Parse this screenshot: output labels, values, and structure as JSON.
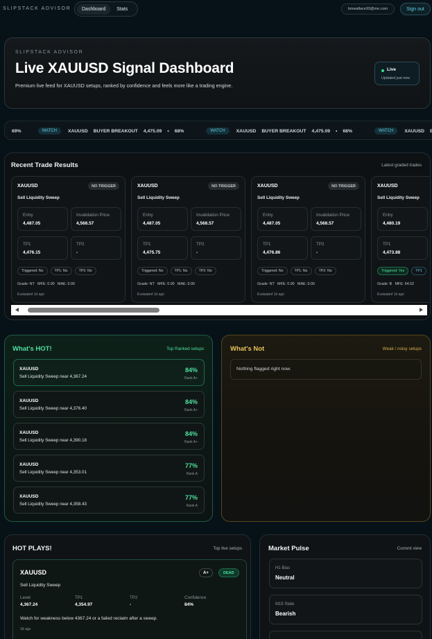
{
  "nav": {
    "brand": "SLIPSTACK ADVISOR",
    "tabs": [
      {
        "label": "Dashboard"
      },
      {
        "label": "Stats"
      }
    ],
    "email": "bmwallace93@me.com",
    "signout": "Sign out"
  },
  "hero": {
    "eyebrow": "SLIPSTACK ADVISOR",
    "title": "Live XAUUSD Signal Dashboard",
    "subtitle": "Premium live feed for XAUUSD setups, ranked by confidence and feels more like a trading engine.",
    "status_label": "Live",
    "status_updated": "Updated just now",
    "status_color": "#37e08b"
  },
  "ticker": {
    "lead_pct": "69%",
    "items": [
      {
        "badge": "WATCH",
        "symbol": "XAUUSD",
        "type": "BUYER BREAKOUT",
        "price": "4,475.09",
        "pct": "68%"
      },
      {
        "badge": "WATCH",
        "symbol": "XAUUSD",
        "type": "BUYER BREAKOUT",
        "price": "4,475.09",
        "pct": "68%"
      },
      {
        "badge": "WATCH",
        "symbol": "XAUUSD",
        "type": "BUYER BREAKOUT",
        "price": "",
        "pct": ""
      }
    ]
  },
  "results": {
    "title": "Recent Trade Results",
    "meta": "Latest graded trades",
    "labels": {
      "entry": "Entry",
      "invalidation": "Invalidation Price",
      "tp1": "TP1",
      "tp2": "TP2",
      "mfe": "MFE:",
      "mae": "MAE:"
    },
    "cards": [
      {
        "symbol": "XAUUSD",
        "badge": "NO TRIGGER",
        "setup": "Sell Liquidity Sweep",
        "entry": "4,487.05",
        "invalidation": "4,568.57",
        "tp1": "4,476.15",
        "tp2": "-",
        "chips": [
          "Triggered: No",
          "TP1: No",
          "TP2: No"
        ],
        "grade": "Grade: NT",
        "mfe": "0.00",
        "mae": "0.00",
        "evaluated": "Evaluated 1d ago"
      },
      {
        "symbol": "XAUUSD",
        "badge": "NO TRIGGER",
        "setup": "Sell Liquidity Sweep",
        "entry": "4,487.05",
        "invalidation": "4,568.57",
        "tp1": "4,475.75",
        "tp2": "-",
        "chips": [
          "Triggered: No",
          "TP1: No",
          "TP2: No"
        ],
        "grade": "Grade: NT",
        "mfe": "0.00",
        "mae": "0.00",
        "evaluated": "Evaluated 1d ago"
      },
      {
        "symbol": "XAUUSD",
        "badge": "NO TRIGGER",
        "setup": "Sell Liquidity Sweep",
        "entry": "4,487.05",
        "invalidation": "4,568.57",
        "tp1": "4,476.86",
        "tp2": "-",
        "chips": [
          "Triggered: No",
          "TP1: No",
          "TP2: No"
        ],
        "grade": "Grade: NT",
        "mfe": "0.00",
        "mae": "0.00",
        "evaluated": "Evaluated 1d ago"
      },
      {
        "symbol": "XAUUSD",
        "badge": "",
        "setup": "Sell Liquidity Sweep",
        "entry": "4,480.19",
        "invalidation": "",
        "tp1": "4,473.88",
        "tp2": "",
        "chips": [
          "Triggered: Yes",
          "TP1"
        ],
        "grade": "Grade: B",
        "mfe": "64.52",
        "mae": "",
        "evaluated": "Evaluated 1d ago"
      }
    ]
  },
  "hot": {
    "title": "What's HOT!",
    "meta": "Top Ranked setups",
    "accent": "#4fe0a1",
    "items": [
      {
        "symbol": "XAUUSD",
        "desc": "Sell Liquidity Sweep near 4,367.24",
        "pct": "84%",
        "rank": "Rank A+"
      },
      {
        "symbol": "XAUUSD",
        "desc": "Sell Liquidity Sweep near 4,376.40",
        "pct": "84%",
        "rank": "Rank A+"
      },
      {
        "symbol": "XAUUSD",
        "desc": "Sell Liquidity Sweep near 4,390.18",
        "pct": "84%",
        "rank": "Rank A+"
      },
      {
        "symbol": "XAUUSD",
        "desc": "Sell Liquidity Sweep near 4,353.01",
        "pct": "77%",
        "rank": "Rank A"
      },
      {
        "symbol": "XAUUSD",
        "desc": "Sell Liquidity Sweep near 4,358.43",
        "pct": "77%",
        "rank": "Rank A"
      }
    ]
  },
  "not": {
    "title": "What's Not",
    "meta": "Weak / noisy setups",
    "accent": "#e8c35a",
    "empty": "Nothing flagged right now."
  },
  "plays": {
    "title": "HOT PLAYS!",
    "meta": "Top live setups",
    "card": {
      "symbol": "XAUUSD",
      "grade": "A+",
      "status": "DEAD",
      "setup": "Sell Liquidity Sweep",
      "fields": [
        {
          "label": "Level",
          "value": "4,367.24"
        },
        {
          "label": "TP1",
          "value": "4,354.97"
        },
        {
          "label": "TP2",
          "value": "-"
        },
        {
          "label": "Confidence",
          "value": "84%"
        }
      ],
      "note": "Watch for weakness below 4367.24 or a failed reclaim after a sweep.",
      "ago": "3d ago"
    }
  },
  "pulse": {
    "title": "Market Pulse",
    "meta": "Current view",
    "items": [
      {
        "label": "H1 Bias",
        "value": "Neutral"
      },
      {
        "label": "M15 State",
        "value": "Bearish"
      }
    ]
  }
}
